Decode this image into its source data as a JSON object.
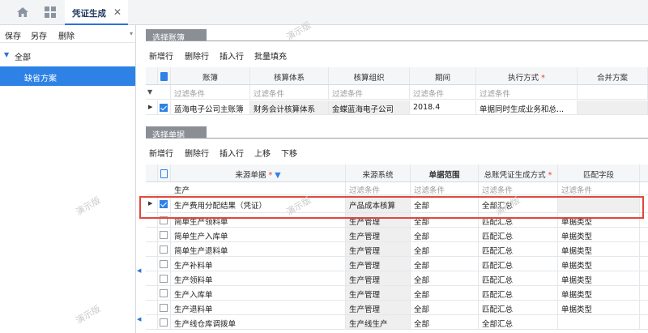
{
  "tab": {
    "title": "凭证生成",
    "close": "✕"
  },
  "left": {
    "toolbar": [
      "保存",
      "另存",
      "删除"
    ],
    "tree_root": "全部",
    "tree_selected": "缺省方案"
  },
  "section1": {
    "title": "选择账簿",
    "toolbar": [
      "新增行",
      "删除行",
      "插入行",
      "批量填充"
    ],
    "columns": [
      "账簿",
      "核算体系",
      "核算组织",
      "期间",
      "执行方式",
      "合并方案"
    ],
    "required_col": 4,
    "filter": [
      "过滤条件",
      "过滤条件",
      "过滤条件",
      "过滤条件",
      "过滤条件"
    ],
    "rows": [
      [
        "蓝海电子公司主账簿",
        "财务会计核算体系",
        "金蝶蓝海电子公司",
        "2018.4",
        "单据同时生成业务和总..."
      ]
    ]
  },
  "section2": {
    "title": "选择单据",
    "toolbar": [
      "新增行",
      "删除行",
      "插入行",
      "上移",
      "下移"
    ],
    "columns": [
      "来源单据",
      "来源系统",
      "单据范围",
      "总账凭证生成方式",
      "匹配字段"
    ],
    "required_cols": [
      0,
      3
    ],
    "group": "生产",
    "filter": [
      "过滤条件",
      "过滤条件",
      "过滤条件",
      "过滤条件"
    ],
    "rows": [
      {
        "checked": true,
        "cells": [
          "生产费用分配结果（凭证）",
          "产品成本核算",
          "全部",
          "全部汇总",
          ""
        ]
      },
      {
        "checked": false,
        "cells": [
          "简单生产领料单",
          "生产管理",
          "全部",
          "匹配汇总",
          "单据类型"
        ]
      },
      {
        "checked": false,
        "cells": [
          "简单生产入库单",
          "生产管理",
          "全部",
          "匹配汇总",
          "单据类型"
        ]
      },
      {
        "checked": false,
        "cells": [
          "简单生产退料单",
          "生产管理",
          "全部",
          "匹配汇总",
          "单据类型"
        ]
      },
      {
        "checked": false,
        "cells": [
          "生产补料单",
          "生产管理",
          "全部",
          "匹配汇总",
          "单据类型"
        ]
      },
      {
        "checked": false,
        "cells": [
          "生产领料单",
          "生产管理",
          "全部",
          "匹配汇总",
          "单据类型"
        ]
      },
      {
        "checked": false,
        "cells": [
          "生产入库单",
          "生产管理",
          "全部",
          "匹配汇总",
          "单据类型"
        ]
      },
      {
        "checked": false,
        "cells": [
          "生产退料单",
          "生产管理",
          "全部",
          "匹配汇总",
          "单据类型"
        ]
      },
      {
        "checked": false,
        "cells": [
          "生产线仓库调拨单",
          "生产线生产",
          "全部",
          "全部汇总",
          ""
        ]
      }
    ]
  },
  "watermark": "演示版",
  "colors": {
    "accent": "#2e82e6",
    "highlight": "#e0483c"
  }
}
